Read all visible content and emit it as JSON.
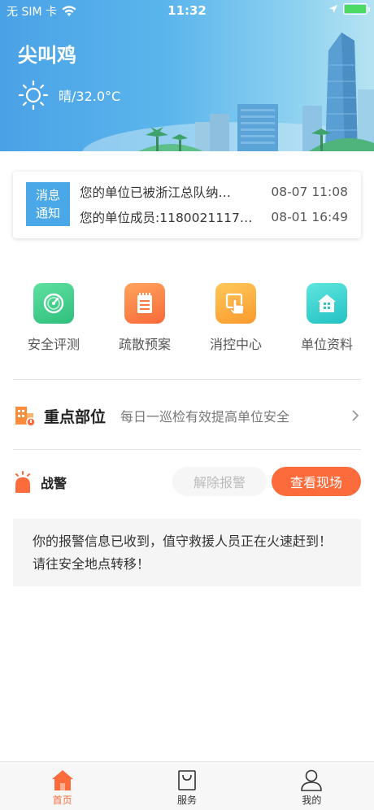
{
  "status_bar": {
    "carrier": "无 SIM 卡",
    "time": "11:32"
  },
  "header": {
    "title": "尖叫鸡",
    "weather": "晴/32.0°C",
    "weather_icon": "sun-icon"
  },
  "messages": {
    "badge_line1": "消息",
    "badge_line2": "通知",
    "items": [
      {
        "text": "您的单位已被浙江总队纳…",
        "time": "08-07 11:08"
      },
      {
        "text": "您的单位成员:1180021117…",
        "time": "08-01 16:49"
      }
    ]
  },
  "actions": [
    {
      "label": "安全评测",
      "icon": "gauge-icon",
      "color": "#3ecf8e"
    },
    {
      "label": "疏散预案",
      "icon": "notepad-icon",
      "color": "#fb7c3c"
    },
    {
      "label": "消控中心",
      "icon": "touch-icon",
      "color": "#fbb034"
    },
    {
      "label": "单位资料",
      "icon": "house-icon",
      "color": "#2ed0c8"
    }
  ],
  "key_location": {
    "title": "重点部位",
    "subtitle": "每日一巡检有效提高单位安全"
  },
  "alarm": {
    "title": "战警",
    "cancel_label": "解除报警",
    "view_label": "查看现场",
    "message": "你的报警信息已收到，值守救援人员正在火速赶到！请往安全地点转移！"
  },
  "tabbar": {
    "tabs": [
      {
        "label": "首页",
        "icon": "home-icon",
        "active": true
      },
      {
        "label": "服务",
        "icon": "shopping-bag-icon",
        "active": false
      },
      {
        "label": "我的",
        "icon": "user-icon",
        "active": false
      }
    ]
  },
  "colors": {
    "accent": "#fb6b3b",
    "badge_blue": "#4aa8e8"
  }
}
